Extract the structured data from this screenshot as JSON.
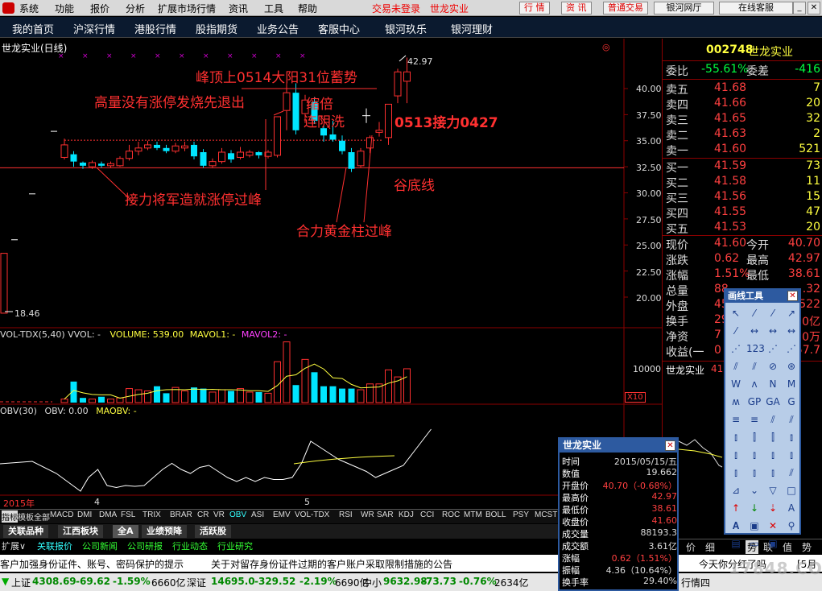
{
  "menubar": {
    "items": [
      "系统",
      "功能",
      "报价",
      "分析",
      "扩展市场行情",
      "资讯",
      "工具",
      "帮助"
    ],
    "alert": "交易未登录",
    "alert_stock": "世龙实业",
    "buttons": [
      "行 情",
      "资 讯",
      "普通交易",
      "银河网厅",
      "在线客服"
    ]
  },
  "navbar": {
    "items": [
      "我的首页",
      "沪深行情",
      "港股行情",
      "股指期货",
      "业务公告",
      "客服中心",
      "银河玖乐",
      "银河理财"
    ]
  },
  "chart": {
    "title": "世龙实业(日线)",
    "annotations": {
      "a1": "峰顶上0514大阳31位蓄势",
      "a2": "高量没有涨停发烧先退出",
      "a3": "缩倍",
      "a4": "连阴洗",
      "a5": "0513接力0427",
      "a6": "谷底线",
      "a7": "接力将军造就涨停过峰",
      "a8": "合力黄金柱过峰"
    },
    "high_label": "42.97",
    "low_label": "18.46",
    "y_ticks": [
      "40.00",
      "37.50",
      "35.00",
      "32.50",
      "30.00",
      "27.50",
      "25.00",
      "22.50",
      "20.00"
    ],
    "vol_header": {
      "title": "VOL-TDX(5,40) VVOL: -",
      "volume": "VOLUME: 539.00",
      "mavol1": "MAVOL1: -",
      "mavol2": "MAVOL2: -"
    },
    "vol_tick": "10000",
    "vol_unit": "X10",
    "obv_header": {
      "title": "OBV(30)",
      "obv": "OBV: 0.00",
      "maobv": "MAOBV: -"
    },
    "date_labels": [
      "2015年",
      "4",
      "5"
    ]
  },
  "chart_data": {
    "type": "candlestick",
    "title": "世龙实业(日线)",
    "ylim": [
      18,
      44
    ],
    "hlines": [
      32.4
    ],
    "candles": [
      {
        "o": 33.4,
        "c": 34.6,
        "h": 35.2,
        "l": 33.2
      },
      {
        "o": 33.7,
        "c": 33.0,
        "h": 34.0,
        "l": 32.5
      },
      {
        "o": 32.9,
        "c": 32.6,
        "h": 33.0,
        "l": 32.3
      },
      {
        "o": 32.5,
        "c": 32.9,
        "h": 33.1,
        "l": 32.3
      },
      {
        "o": 32.8,
        "c": 32.6,
        "h": 33.0,
        "l": 32.4
      },
      {
        "o": 32.6,
        "c": 32.8,
        "h": 33.0,
        "l": 32.4
      },
      {
        "o": 32.6,
        "c": 33.3,
        "h": 33.5,
        "l": 32.5
      },
      {
        "o": 33.3,
        "c": 34.0,
        "h": 34.6,
        "l": 33.1
      },
      {
        "o": 34.0,
        "c": 34.3,
        "h": 34.9,
        "l": 33.6
      },
      {
        "o": 34.3,
        "c": 34.6,
        "h": 35.0,
        "l": 34.1
      },
      {
        "o": 34.6,
        "c": 34.3,
        "h": 34.9,
        "l": 34.1
      },
      {
        "o": 34.3,
        "c": 34.0,
        "h": 34.6,
        "l": 33.8
      },
      {
        "o": 34.0,
        "c": 34.5,
        "h": 34.8,
        "l": 33.8
      },
      {
        "o": 34.3,
        "c": 34.5,
        "h": 34.9,
        "l": 34.0
      },
      {
        "o": 34.6,
        "c": 33.5,
        "h": 34.9,
        "l": 33.2
      },
      {
        "o": 33.9,
        "c": 32.6,
        "h": 34.2,
        "l": 32.4
      },
      {
        "o": 32.6,
        "c": 33.0,
        "h": 33.3,
        "l": 32.4
      },
      {
        "o": 33.0,
        "c": 33.9,
        "h": 34.3,
        "l": 32.8
      },
      {
        "o": 33.8,
        "c": 33.2,
        "h": 34.1,
        "l": 32.9
      },
      {
        "o": 33.4,
        "c": 33.9,
        "h": 34.4,
        "l": 33.2
      },
      {
        "o": 33.6,
        "c": 33.9,
        "h": 34.1,
        "l": 33.4
      },
      {
        "o": 33.9,
        "c": 33.6,
        "h": 34.0,
        "l": 33.3
      },
      {
        "o": 33.5,
        "c": 33.9,
        "h": 34.1,
        "l": 33.3
      },
      {
        "o": 33.6,
        "c": 37.3,
        "h": 37.3,
        "l": 33.4
      },
      {
        "o": 37.9,
        "c": 39.6,
        "h": 40.5,
        "l": 36.0
      },
      {
        "o": 39.6,
        "c": 36.0,
        "h": 40.5,
        "l": 35.6
      },
      {
        "o": 37.6,
        "c": 38.9,
        "h": 39.4,
        "l": 36.7
      },
      {
        "o": 38.7,
        "c": 36.9,
        "h": 39.2,
        "l": 36.6
      },
      {
        "o": 36.2,
        "c": 35.5,
        "h": 36.4,
        "l": 34.9
      },
      {
        "o": 35.6,
        "c": 35.1,
        "h": 36.9,
        "l": 34.9
      },
      {
        "o": 35.0,
        "c": 34.0,
        "h": 35.5,
        "l": 33.7
      },
      {
        "o": 33.9,
        "c": 32.3,
        "h": 34.3,
        "l": 32.0
      },
      {
        "o": 32.6,
        "c": 34.0,
        "h": 34.3,
        "l": 32.4
      },
      {
        "o": 34.3,
        "c": 35.3,
        "h": 35.5,
        "l": 33.8
      },
      {
        "o": 35.8,
        "c": 36.0,
        "h": 36.8,
        "l": 35.4
      },
      {
        "o": 35.3,
        "c": 38.5,
        "h": 38.5,
        "l": 34.6
      },
      {
        "o": 39.3,
        "c": 41.6,
        "h": 41.9,
        "l": 38.6
      },
      {
        "o": 40.7,
        "c": 41.6,
        "h": 42.97,
        "l": 38.6
      }
    ],
    "volume": [
      3,
      18,
      4,
      3,
      5,
      3,
      4,
      12,
      11,
      10,
      14,
      8,
      13,
      10,
      13,
      12,
      9,
      11,
      10,
      12,
      9,
      9,
      8,
      35,
      52,
      15,
      37,
      26,
      14,
      14,
      12,
      12,
      11,
      16,
      16,
      28,
      22,
      29
    ],
    "obv": [
      -0.3,
      -0.1,
      -0.5,
      -0.55,
      -0.5,
      -0.52,
      -0.5,
      -0.3,
      -0.1,
      0.05,
      -0.1,
      -0.2,
      -0.05,
      0.0,
      -0.15,
      -0.3,
      -0.4,
      -0.3,
      -0.4,
      -0.3,
      -0.35,
      -0.35,
      -0.3,
      0.05,
      0.6,
      0.45,
      0.3,
      0.15,
      0.05,
      -0.05,
      -0.15,
      -0.3,
      -0.2,
      -0.1,
      0.0,
      0.3,
      0.6,
      0.9
    ]
  },
  "quote": {
    "code": "002748",
    "name": "世龙实业",
    "ratio_label": "委比",
    "ratio": "-55.61%",
    "diff_label": "委差",
    "diff": "-416",
    "asks": [
      {
        "label": "卖五",
        "price": "41.68",
        "vol": "7"
      },
      {
        "label": "卖四",
        "price": "41.66",
        "vol": "20"
      },
      {
        "label": "卖三",
        "price": "41.65",
        "vol": "32"
      },
      {
        "label": "卖二",
        "price": "41.63",
        "vol": "2"
      },
      {
        "label": "卖一",
        "price": "41.60",
        "vol": "521"
      }
    ],
    "bids": [
      {
        "label": "买一",
        "price": "41.59",
        "vol": "73"
      },
      {
        "label": "买二",
        "price": "41.58",
        "vol": "11"
      },
      {
        "label": "买三",
        "price": "41.56",
        "vol": "15"
      },
      {
        "label": "买四",
        "price": "41.55",
        "vol": "47"
      },
      {
        "label": "买五",
        "price": "41.53",
        "vol": "20"
      }
    ],
    "stats": [
      {
        "l1": "现价",
        "v1": "41.60",
        "l2": "今开",
        "v2": "40.70"
      },
      {
        "l1": "涨跌",
        "v1": "0.62",
        "l2": "最高",
        "v2": "42.97"
      },
      {
        "l1": "涨幅",
        "v1": "1.51%",
        "l2": "最低",
        "v2": "38.61"
      },
      {
        "l1": "总量",
        "v1": "88",
        "l2": "",
        "v2": ".32"
      },
      {
        "l1": "外盘",
        "v1": "45",
        "l2": "",
        "v2": "522"
      },
      {
        "l1": "换手",
        "v1": "29.4",
        "l2": "",
        "v2": "0亿"
      },
      {
        "l1": "净资",
        "v1": "7",
        "l2": "",
        "v2": "0万"
      },
      {
        "l1": "收益(一",
        "v1": "0",
        "l2": "",
        "v2": "57.7"
      }
    ],
    "mini_name": "世龙实业",
    "mini_val": "41",
    "bottom_tabs": [
      "价",
      "细",
      "势",
      "联",
      "值",
      "势"
    ]
  },
  "draw_tools": {
    "title": "画线工具",
    "close": "✕"
  },
  "popup": {
    "title": "世龙实业",
    "close": "✕",
    "rows": [
      {
        "k": "时间",
        "v": "2015/05/15/五"
      },
      {
        "k": "数值",
        "v": "19.662"
      },
      {
        "k": "开盘价",
        "v": "40.70（-0.68%）"
      },
      {
        "k": "最高价",
        "v": "42.97"
      },
      {
        "k": "最低价",
        "v": "38.61"
      },
      {
        "k": "收盘价",
        "v": "41.60"
      },
      {
        "k": "成交量",
        "v": "88193.3"
      },
      {
        "k": "成交额",
        "v": "3.61亿"
      },
      {
        "k": "涨幅",
        "v": "0.62（1.51%）"
      },
      {
        "k": "振幅",
        "v": "4.36（10.64%）"
      },
      {
        "k": "换手率",
        "v": "29.40%"
      }
    ]
  },
  "indicator_tabs": [
    "指标",
    "模板",
    "全部",
    "MACD",
    "DMI",
    "DMA",
    "FSL",
    "TRIX",
    "BRAR",
    "CR",
    "VR",
    "OBV",
    "ASI",
    "EMV",
    "VOL-TDX",
    "RSI",
    "WR",
    "SAR",
    "KDJ",
    "CCI",
    "ROC",
    "MTM",
    "BOLL",
    "PSY",
    "MCST"
  ],
  "sector_tabs": [
    "关联品种",
    "江西板块",
    "全A",
    "业绩预降",
    "活跃股"
  ],
  "info_tabs": [
    "扩展∨",
    "关联报价",
    "公司新闻",
    "公司研报",
    "行业动态",
    "行业研究"
  ],
  "news": {
    "n1": "客户加强身份证件、账号、密码保护的提示",
    "n2": "关于对留存身份证件过期的客户账户采取限制措施的公告",
    "n3": "今天你分红了吗",
    "n4": "[5月1"
  },
  "status": {
    "sh_label": "上证",
    "sh": "4308.69",
    "sh_chg": "-69.62",
    "sh_pct": "-1.59%",
    "sh_amt": "6660亿",
    "sz_label": "深证",
    "sz": "14695.0",
    "sz_chg": "-329.52",
    "sz_pct": "-2.19%",
    "sz_amt": "6690亿",
    "zx_label": "中小",
    "zx": "9632.98",
    "zx_chg": "-73.73",
    "zx_pct": "-0.76%",
    "zx_amt": "2634亿",
    "tail": "行情四"
  },
  "watermark": "17848.COM",
  "colors": {
    "up": "#ff3030",
    "down": "#00e5ff",
    "bg": "#000000",
    "accent": "#2d5aa0"
  }
}
